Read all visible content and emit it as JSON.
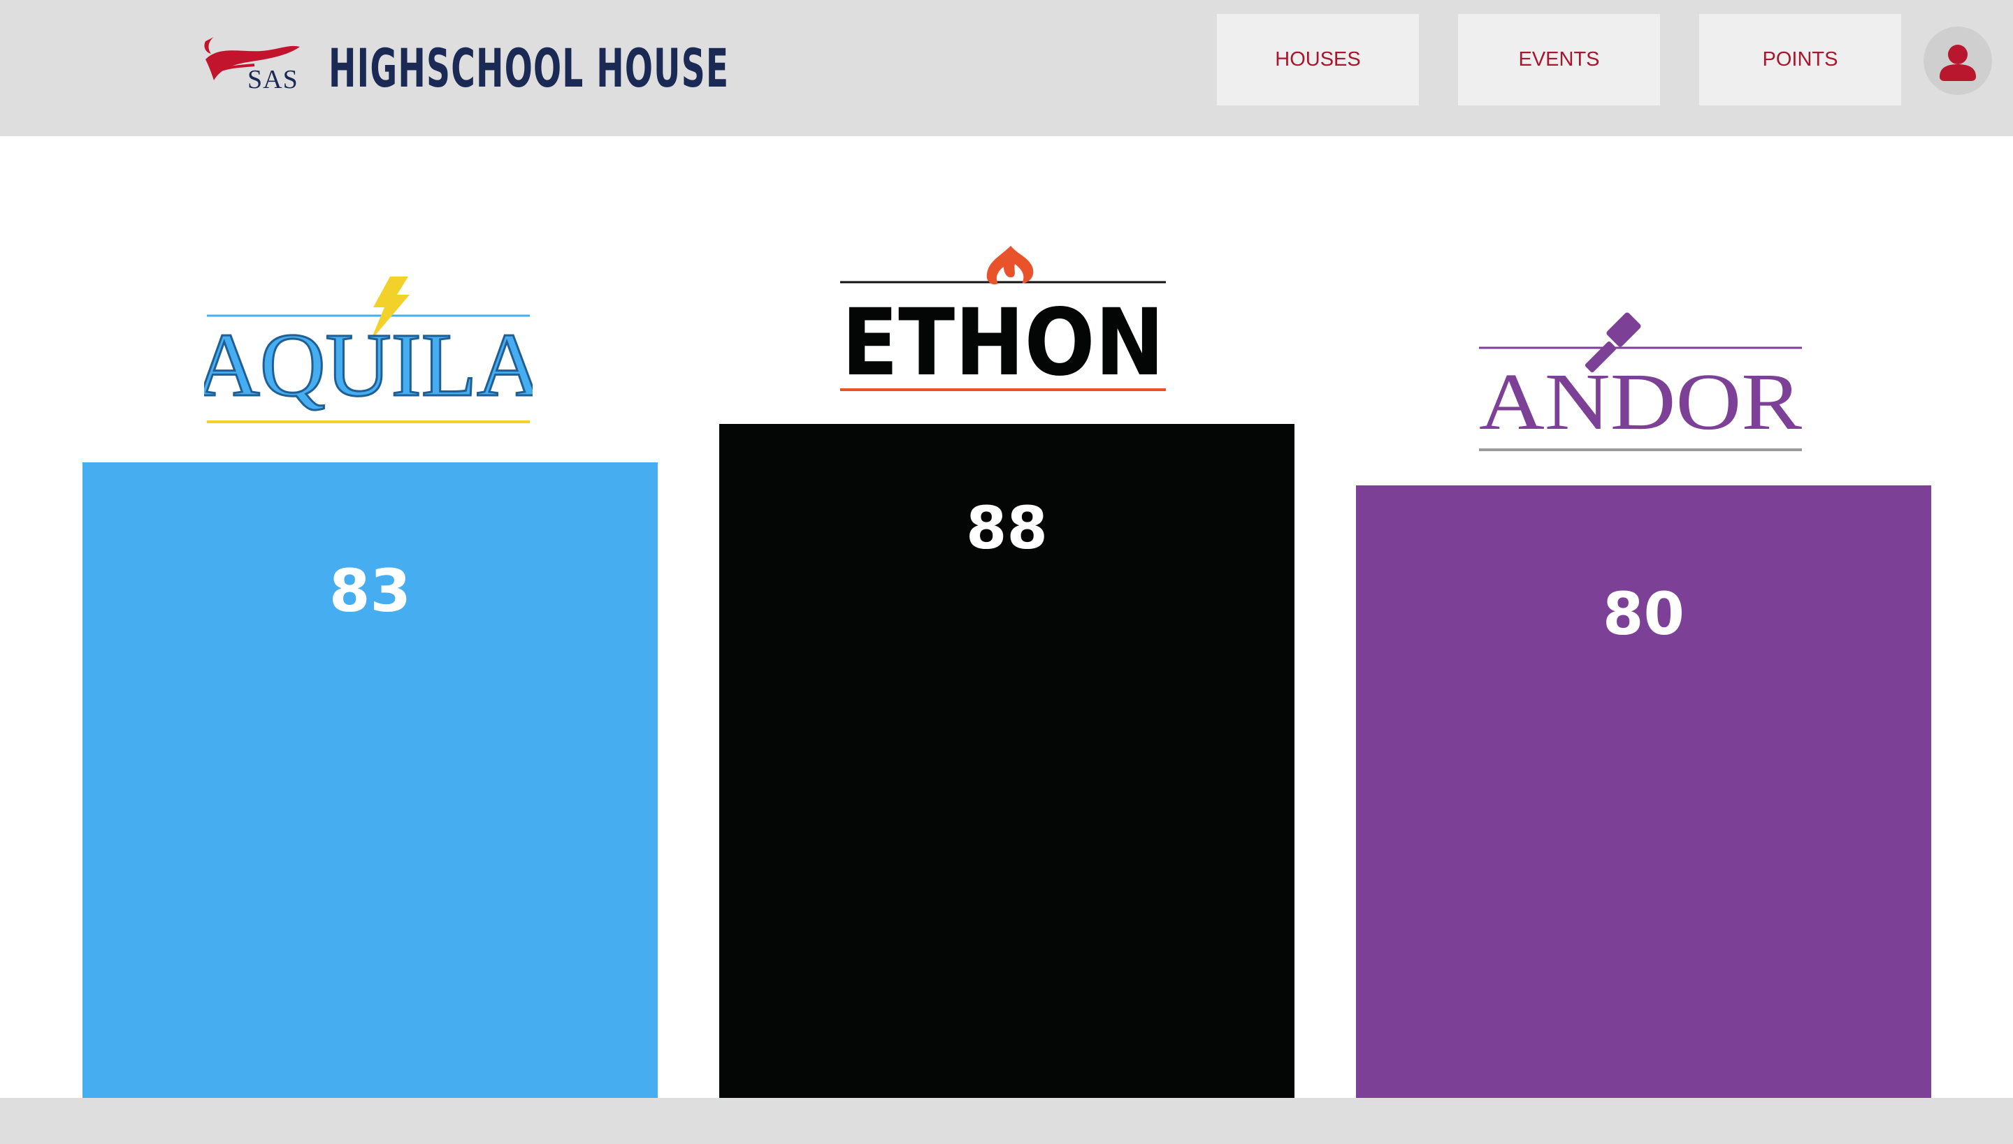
{
  "header": {
    "logo_text": "SAS",
    "title": "HIGHSCHOOL HOUSE",
    "nav": {
      "houses": "HOUSES",
      "events": "EVENTS",
      "points": "POINTS"
    },
    "avatar_icon": "user-icon"
  },
  "colors": {
    "header_bg": "#dedede",
    "nav_text": "#a8172d",
    "title_text": "#1b2a55",
    "aquila": "#46aef0",
    "ethon": "#040505",
    "andor": "#7c4096"
  },
  "houses": [
    {
      "name": "AQUILA",
      "points": "83",
      "color": "#46aef0",
      "accent": "#f2d12b",
      "icon": "lightning-bolt-icon"
    },
    {
      "name": "ETHON",
      "points": "88",
      "color": "#040505",
      "accent": "#e9532b",
      "icon": "flame-icon"
    },
    {
      "name": "ANDOR",
      "points": "80",
      "color": "#7c4096",
      "accent": "#9a9a9a",
      "icon": "hammer-icon"
    }
  ],
  "chart_data": {
    "type": "bar",
    "categories": [
      "AQUILA",
      "ETHON",
      "ANDOR"
    ],
    "values": [
      83,
      88,
      80
    ]
  }
}
